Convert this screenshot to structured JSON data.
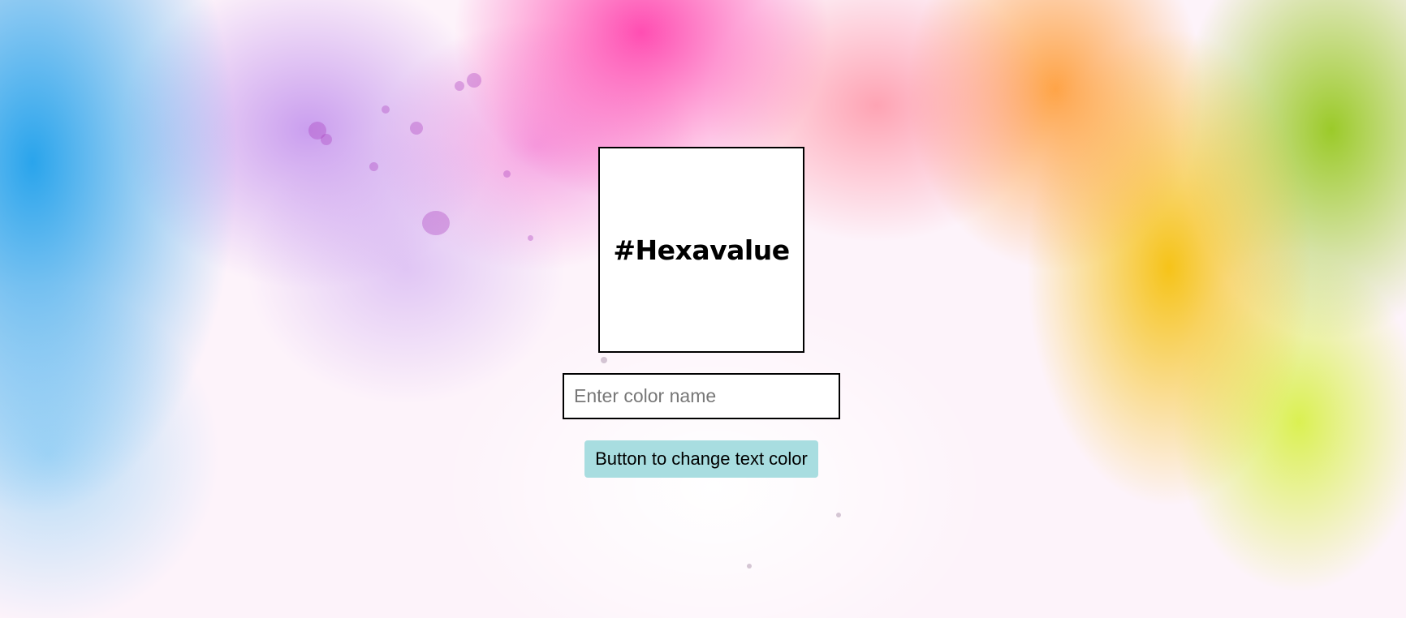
{
  "hex_display": {
    "text": "#Hexavalue"
  },
  "color_input": {
    "value": "",
    "placeholder": "Enter color name"
  },
  "change_button": {
    "label": "Button to change text color"
  },
  "colors": {
    "box_background": "#ffffff",
    "box_border": "#000000",
    "button_background": "#a8dde0",
    "hex_text": "#000000"
  },
  "background": {
    "style": "watercolor-splash"
  }
}
